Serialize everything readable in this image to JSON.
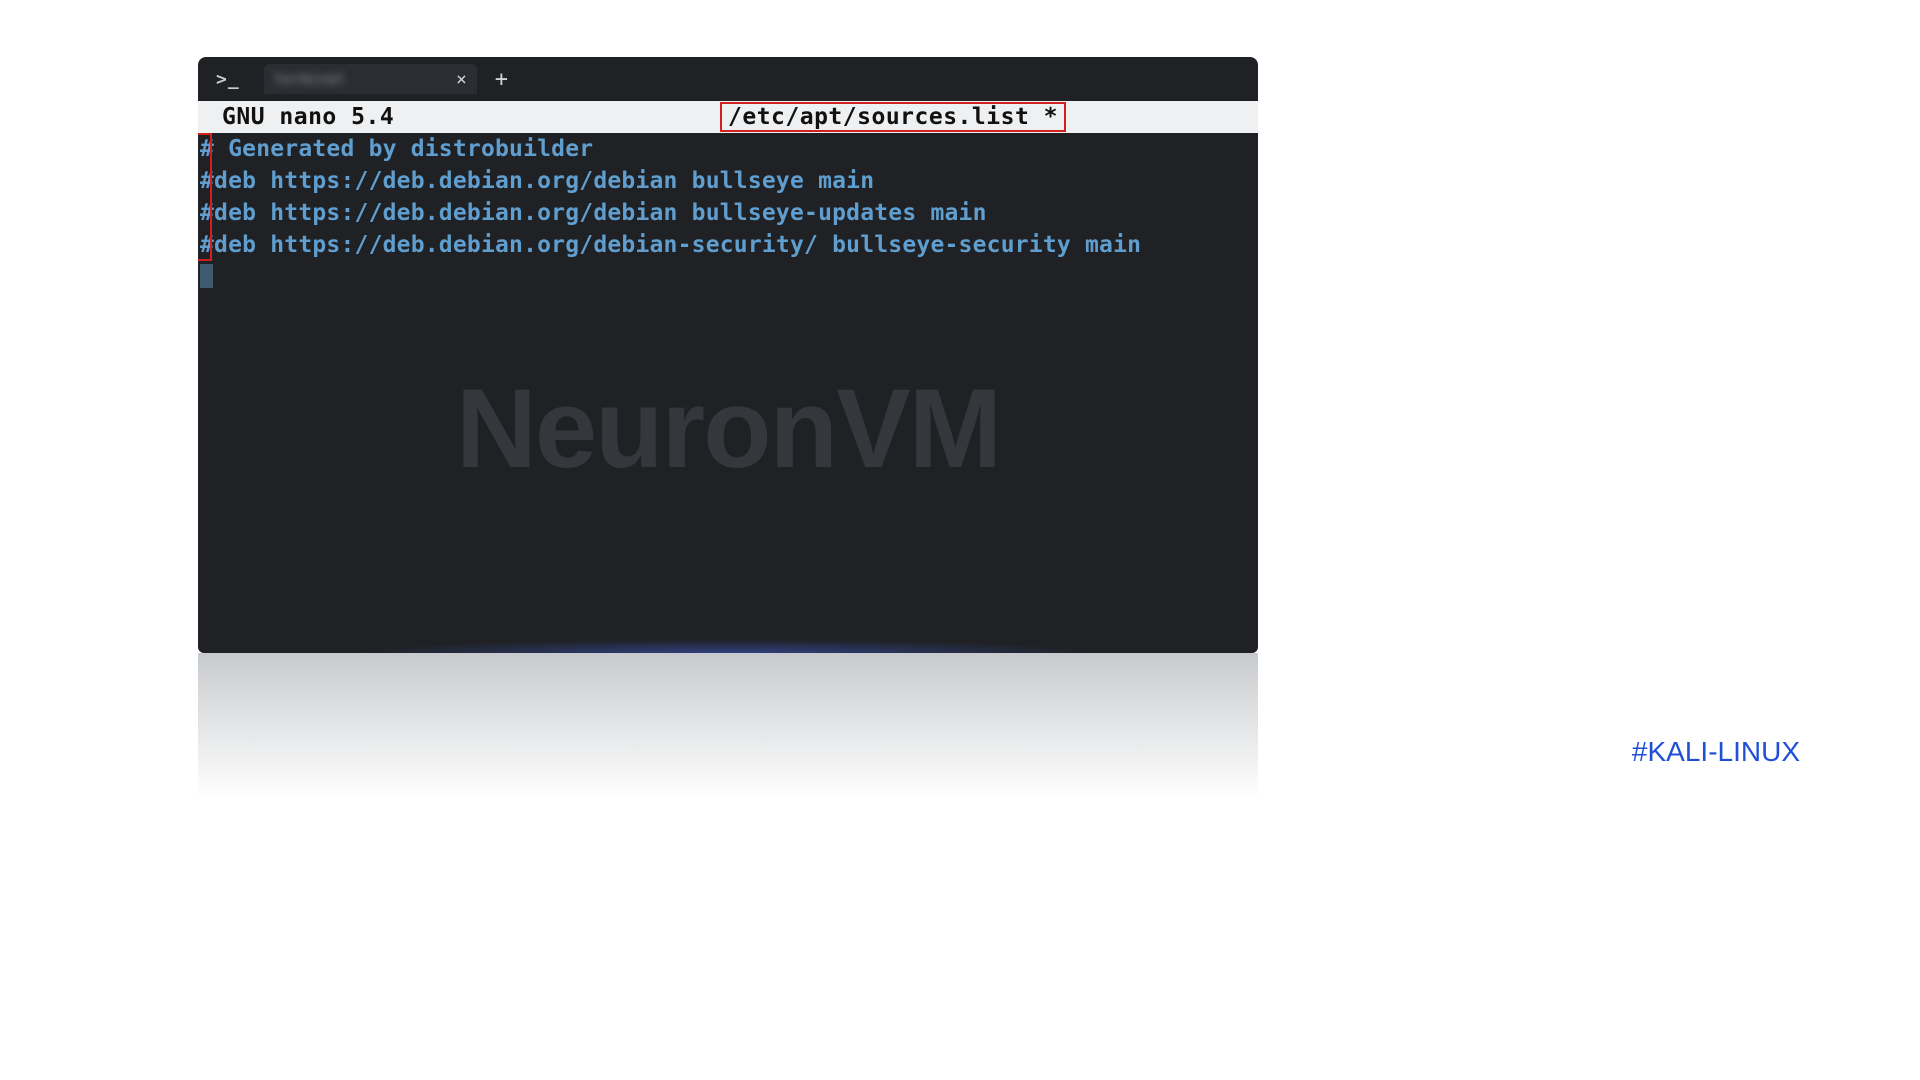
{
  "titlebar": {
    "prompt_glyph": ">_",
    "tab_label": "terminal",
    "tab_close_glyph": "×",
    "new_tab_glyph": "+"
  },
  "nano": {
    "app_title": "GNU nano 5.4",
    "file_path": "/etc/apt/sources.list *"
  },
  "editor": {
    "lines": [
      "# Generated by distrobuilder",
      "#deb https://deb.debian.org/debian bullseye main",
      "#deb https://deb.debian.org/debian bullseye-updates main",
      "#deb https://deb.debian.org/debian-security/ bullseye-security main"
    ]
  },
  "watermark": "NeuronVM",
  "hashtag": "#KALI-LINUX"
}
